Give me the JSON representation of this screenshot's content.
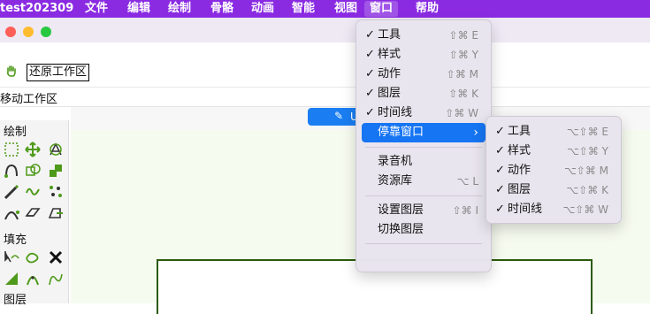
{
  "menubar": {
    "app": "test202309",
    "items": [
      "文件",
      "编辑",
      "绘制",
      "骨骼",
      "动画",
      "智能",
      "视图",
      "窗口",
      "帮助"
    ]
  },
  "toolbar": {
    "restore_label": "还原工作区",
    "move_label": "移动工作区"
  },
  "blue_button": {
    "label": "U"
  },
  "panels": {
    "draw_title": "绘制",
    "fill_title": "填充",
    "layer_title": "图层"
  },
  "window_menu": {
    "items": [
      {
        "label": "工具",
        "check": "✓",
        "shortcut": "⇧⌘ E"
      },
      {
        "label": "样式",
        "check": "✓",
        "shortcut": "⇧⌘ Y"
      },
      {
        "label": "动作",
        "check": "✓",
        "shortcut": "⇧⌘ M"
      },
      {
        "label": "图层",
        "check": "✓",
        "shortcut": "⇧⌘ K"
      },
      {
        "label": "时间线",
        "check": "✓",
        "shortcut": "⇧⌘ W"
      },
      {
        "label": "停靠窗口",
        "check": "",
        "shortcut": "›"
      },
      {
        "label": "录音机",
        "check": "",
        "shortcut": ""
      },
      {
        "label": "资源库",
        "check": "",
        "shortcut": "⌥ L"
      },
      {
        "label": "设置图层",
        "check": "",
        "shortcut": "⇧⌘ I"
      },
      {
        "label": "切换图层",
        "check": "",
        "shortcut": ""
      }
    ]
  },
  "dock_submenu": {
    "items": [
      {
        "label": "工具",
        "check": "✓",
        "shortcut": "⌥⇧⌘ E"
      },
      {
        "label": "样式",
        "check": "✓",
        "shortcut": "⌥⇧⌘ Y"
      },
      {
        "label": "动作",
        "check": "✓",
        "shortcut": "⌥⇧⌘ M"
      },
      {
        "label": "图层",
        "check": "✓",
        "shortcut": "⌥⇧⌘ K"
      },
      {
        "label": "时间线",
        "check": "✓",
        "shortcut": "⌥⇧⌘ W"
      }
    ]
  },
  "colors": {
    "menubar": "#8a2be2",
    "highlight": "#1675f3",
    "tool_green": "#4f9a1a",
    "stage_border": "#2b5b0d"
  }
}
